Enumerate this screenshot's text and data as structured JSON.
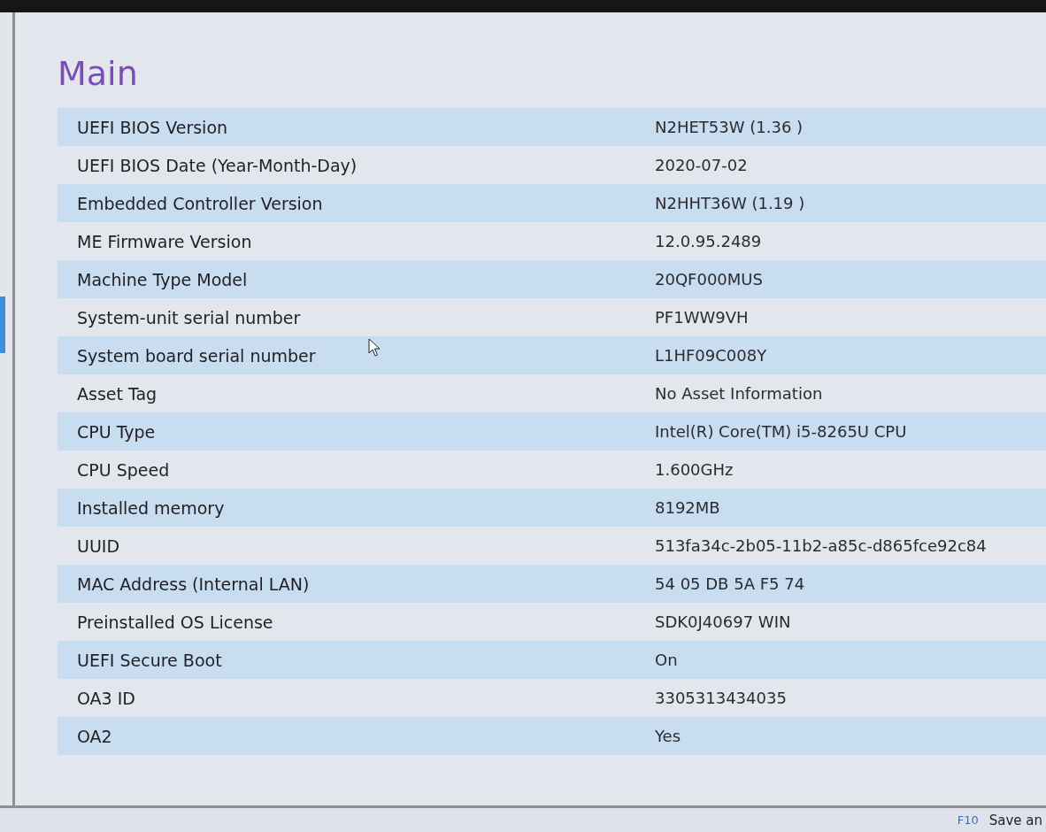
{
  "header": {
    "title": "Main"
  },
  "rows": [
    {
      "label": "UEFI BIOS Version",
      "value": "N2HET53W (1.36 )"
    },
    {
      "label": "UEFI BIOS Date (Year-Month-Day)",
      "value": "2020-07-02"
    },
    {
      "label": "Embedded Controller Version",
      "value": "N2HHT36W (1.19 )"
    },
    {
      "label": "ME Firmware Version",
      "value": "12.0.95.2489"
    },
    {
      "label": "Machine Type Model",
      "value": "20QF000MUS"
    },
    {
      "label": "System-unit serial number",
      "value": "PF1WW9VH"
    },
    {
      "label": "System board serial number",
      "value": "L1HF09C008Y"
    },
    {
      "label": "Asset Tag",
      "value": "No Asset Information"
    },
    {
      "label": "CPU Type",
      "value": "Intel(R) Core(TM) i5-8265U CPU"
    },
    {
      "label": "CPU Speed",
      "value": "1.600GHz"
    },
    {
      "label": "Installed memory",
      "value": "8192MB"
    },
    {
      "label": "UUID",
      "value": "513fa34c-2b05-11b2-a85c-d865fce92c84"
    },
    {
      "label": "MAC Address (Internal LAN)",
      "value": "54 05 DB 5A F5 74"
    },
    {
      "label": "Preinstalled OS License",
      "value": "SDK0J40697 WIN"
    },
    {
      "label": "UEFI Secure Boot",
      "value": "On"
    },
    {
      "label": "OA3 ID",
      "value": "3305313434035"
    },
    {
      "label": "OA2",
      "value": "Yes"
    }
  ],
  "footer": {
    "items": [
      {
        "key": "F10",
        "action": "Save an"
      }
    ]
  }
}
